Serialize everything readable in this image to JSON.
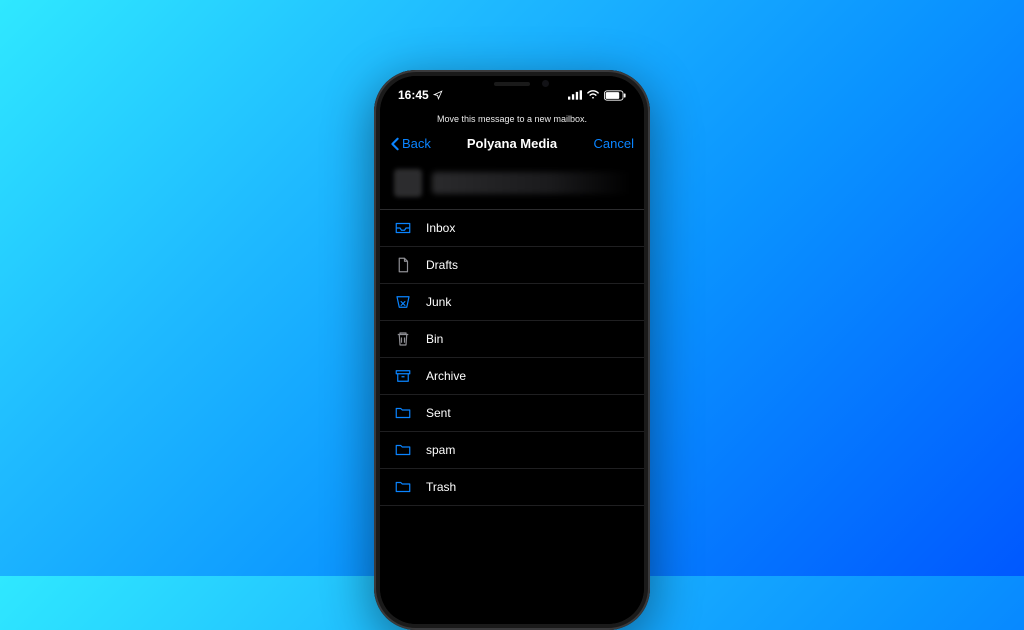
{
  "status": {
    "time": "16:45"
  },
  "instruction": "Move this message to a new mailbox.",
  "nav": {
    "back": "Back",
    "title": "Polyana Media",
    "cancel": "Cancel"
  },
  "mailboxes": [
    {
      "icon": "inbox",
      "label": "Inbox",
      "muted": false
    },
    {
      "icon": "drafts",
      "label": "Drafts",
      "muted": true
    },
    {
      "icon": "junk",
      "label": "Junk",
      "muted": false
    },
    {
      "icon": "bin",
      "label": "Bin",
      "muted": true
    },
    {
      "icon": "archive",
      "label": "Archive",
      "muted": false
    },
    {
      "icon": "folder",
      "label": "Sent",
      "muted": false
    },
    {
      "icon": "folder",
      "label": "spam",
      "muted": false
    },
    {
      "icon": "folder",
      "label": "Trash",
      "muted": false
    }
  ],
  "colors": {
    "accent": "#0a84ff",
    "muted": "#8e8e93"
  }
}
